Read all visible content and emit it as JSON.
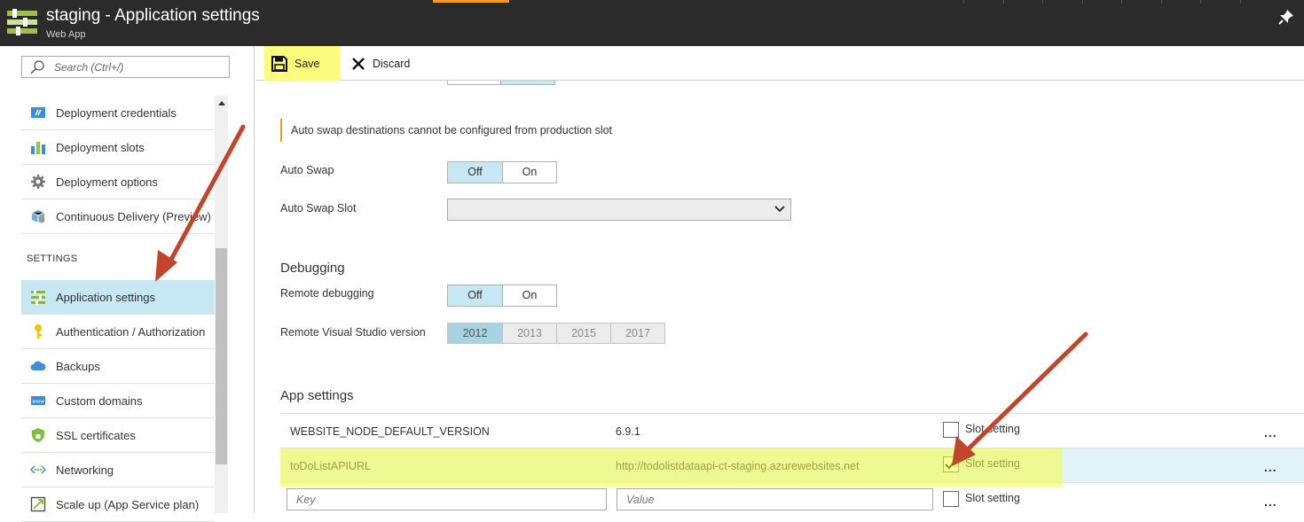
{
  "header": {
    "title": "staging - Application settings",
    "subtitle": "Web App"
  },
  "search": {
    "placeholder": "Search (Ctrl+/)"
  },
  "nav": {
    "items_top": [
      {
        "label": "Deployment credentials",
        "icon": "deployment-credentials-icon"
      },
      {
        "label": "Deployment slots",
        "icon": "deployment-slots-icon"
      },
      {
        "label": "Deployment options",
        "icon": "gear-icon"
      },
      {
        "label": "Continuous Delivery (Preview)",
        "icon": "continuous-delivery-icon"
      }
    ],
    "section_header": "SETTINGS",
    "items_settings": [
      {
        "label": "Application settings",
        "icon": "app-settings-icon",
        "active": true
      },
      {
        "label": "Authentication / Authorization",
        "icon": "key-icon"
      },
      {
        "label": "Backups",
        "icon": "cloud-icon"
      },
      {
        "label": "Custom domains",
        "icon": "www-icon"
      },
      {
        "label": "SSL certificates",
        "icon": "shield-icon"
      },
      {
        "label": "Networking",
        "icon": "networking-icon"
      },
      {
        "label": "Scale up (App Service plan)",
        "icon": "scale-up-icon"
      }
    ]
  },
  "toolbar": {
    "save_label": "Save",
    "discard_label": "Discard"
  },
  "info_message": "Auto swap destinations cannot be configured from production slot",
  "auto_swap": {
    "label": "Auto Swap",
    "off": "Off",
    "on": "On",
    "selected": "Off"
  },
  "auto_swap_slot": {
    "label": "Auto Swap Slot",
    "value": ""
  },
  "debugging": {
    "title": "Debugging",
    "remote_debugging_label": "Remote debugging",
    "off": "Off",
    "on": "On",
    "selected": "Off",
    "vs_label": "Remote Visual Studio version",
    "vs_versions": [
      "2012",
      "2013",
      "2015",
      "2017"
    ],
    "vs_selected": "2012"
  },
  "app_settings": {
    "title": "App settings",
    "rows": [
      {
        "key": "WEBSITE_NODE_DEFAULT_VERSION",
        "value": "6.9.1",
        "slot_label": "Slot setting",
        "slot_checked": false
      },
      {
        "key": "toDoListAPIURL",
        "value": "http://todolistdataapi-ct-staging.azurewebsites.net",
        "slot_label": "Slot setting",
        "slot_checked": true
      }
    ],
    "new_row": {
      "key_placeholder": "Key",
      "value_placeholder": "Value",
      "slot_label": "Slot setting"
    },
    "more_label": "..."
  },
  "colors": {
    "topbar": "#2b2b2b",
    "active_nav": "#c7e8f3",
    "highlight": "#f6ff3c",
    "arrow": "#c0452a",
    "accent": "#f59b1d"
  }
}
